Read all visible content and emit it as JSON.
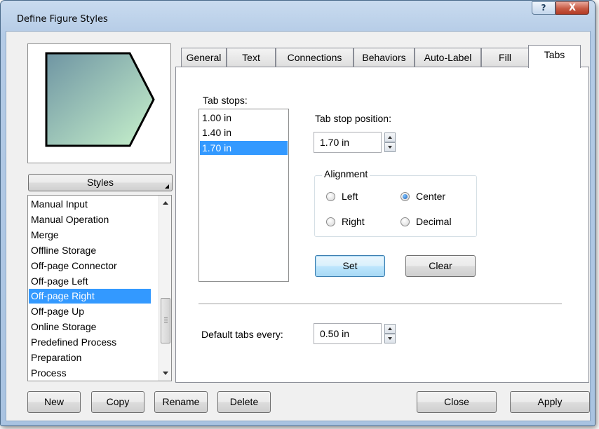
{
  "window": {
    "title": "Define Figure Styles",
    "help_glyph": "?",
    "close_glyph": "X"
  },
  "preview": {
    "shape": "Off-page Right",
    "fill_start": "#6f95a3",
    "fill_end": "#c8f2cc"
  },
  "styles_button": {
    "label": "Styles"
  },
  "style_list": {
    "items": [
      "Manual Input",
      "Manual Operation",
      "Merge",
      "Offline Storage",
      "Off-page Connector",
      "Off-page Left",
      "Off-page Right",
      "Off-page Up",
      "Online Storage",
      "Predefined Process",
      "Preparation",
      "Process"
    ],
    "selected": "Off-page Right"
  },
  "tabs": {
    "items": [
      "General",
      "Text",
      "Connections",
      "Behaviors",
      "Auto-Label",
      "Fill",
      "Tabs"
    ],
    "active": "Tabs"
  },
  "tabs_panel": {
    "tab_stops_label": "Tab stops:",
    "tab_stops": [
      "1.00 in",
      "1.40 in",
      "1.70 in"
    ],
    "selected_stop": "1.70 in",
    "position_label": "Tab stop position:",
    "position_value": "1.70 in",
    "alignment_label": "Alignment",
    "alignment": {
      "left": "Left",
      "center": "Center",
      "right": "Right",
      "decimal": "Decimal",
      "selected": "Center"
    },
    "set_label": "Set",
    "clear_label": "Clear",
    "default_label": "Default tabs every:",
    "default_value": "0.50 in"
  },
  "footer": {
    "new": "New",
    "copy": "Copy",
    "rename": "Rename",
    "delete": "Delete",
    "close": "Close",
    "apply": "Apply"
  },
  "colors": {
    "selection": "#3399ff",
    "frame": "#b4cbe6"
  }
}
